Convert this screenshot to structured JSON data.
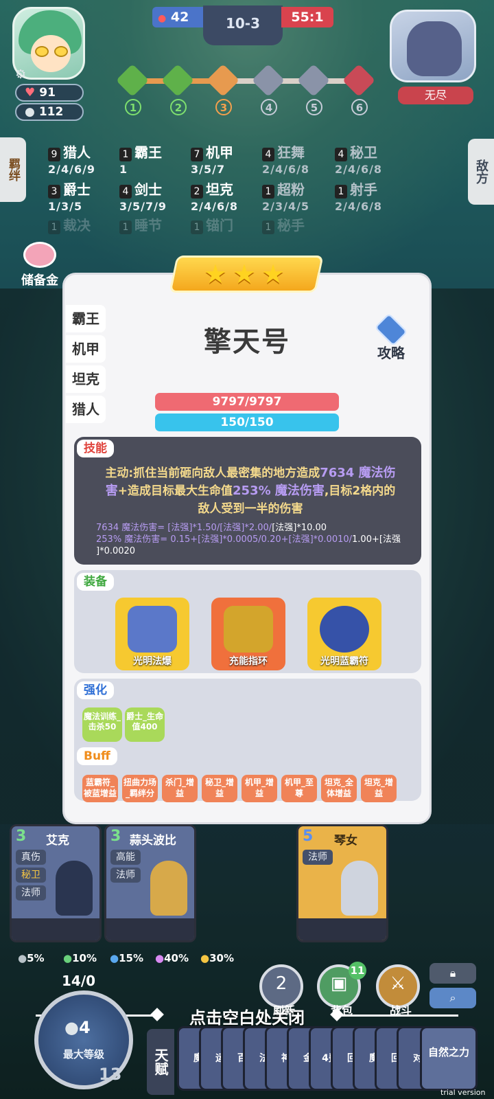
{
  "hud": {
    "enemy_kills": "42",
    "round": "10-3",
    "score": "55:1",
    "hp": "91",
    "coins": "112",
    "enemy_name": "无尽",
    "stages": [
      "1",
      "2",
      "3",
      "4",
      "5",
      "6"
    ]
  },
  "traits": {
    "tab_left": "羁绊",
    "tab_right": "敌方",
    "items": [
      {
        "count": "9",
        "name": "猎人",
        "levels": "2/4/6/9"
      },
      {
        "count": "1",
        "name": "霸王",
        "levels": "1"
      },
      {
        "count": "7",
        "name": "机甲",
        "levels": "3/5/7"
      },
      {
        "count": "4",
        "name": "狂舞",
        "levels": "2/4/6/8"
      },
      {
        "count": "4",
        "name": "秘卫",
        "levels": "2/4/6/8"
      },
      {
        "count": "3",
        "name": "爵士",
        "levels": "1/3/5"
      },
      {
        "count": "4",
        "name": "剑士",
        "levels": "3/5/7/9"
      },
      {
        "count": "2",
        "name": "坦克",
        "levels": "2/4/6/8"
      },
      {
        "count": "1",
        "name": "超粉",
        "levels": "2/3/4/5"
      },
      {
        "count": "1",
        "name": "射手",
        "levels": "2/4/6/8"
      },
      {
        "count": "1",
        "name": "裁决",
        "levels": ""
      },
      {
        "count": "1",
        "name": "睡节",
        "levels": ""
      },
      {
        "count": "1",
        "name": "锚门",
        "levels": ""
      },
      {
        "count": "1",
        "name": "秘手",
        "levels": ""
      }
    ]
  },
  "piggy_label": "储备金",
  "hero": {
    "name": "擎天号",
    "stars": "★★★",
    "trait_tabs": [
      "霸王",
      "机甲",
      "坦克",
      "猎人"
    ],
    "strategy_label": "攻略",
    "hp": "9797/9797",
    "mp": "150/150"
  },
  "skill": {
    "tag": "技能",
    "line1a": "主动:抓住当前砸向敌人最密集的地方造成",
    "line1b": "7634 魔法伤",
    "line2a": "害",
    "line2b": "+造成目标最大生命值",
    "line2c": "253% 魔法伤害",
    "line2d": ",目标2格内的",
    "line3": "敌人受到一半的伤害",
    "formula1a": "7634 魔法伤害= [法强]*1.50/[法强]*2.00/",
    "formula1b": "[法强]*10.00",
    "formula2a": "253% 魔法伤害= 0.15+[法强]*0.0005/0.20+[法强]*0.0010/",
    "formula2b": "1.00+[法强",
    "formula3": "]*0.0020"
  },
  "equipment": {
    "tag": "装备",
    "items": [
      {
        "name": "光明法爆",
        "icon": "gauntlet-icon",
        "color": "#f6c930"
      },
      {
        "name": "充能指环",
        "icon": "ring-icon",
        "color": "#f0703c"
      },
      {
        "name": "光明蓝霸符",
        "icon": "orb-icon",
        "color": "#f6c930"
      }
    ]
  },
  "boost": {
    "tag": "强化",
    "items": [
      "魔法训练_击杀50",
      "爵士_生命值400"
    ]
  },
  "buff": {
    "tag": "Buff",
    "items": [
      "蓝霸符_被蓝增益",
      "扭曲力场_羁绊分",
      "杀门_增益",
      "秘卫_增益",
      "机甲_增益",
      "机甲_至尊",
      "坦克_全体增益",
      "坦克_增益"
    ]
  },
  "shop": [
    {
      "cost": "3",
      "name": "艾克",
      "tags": [
        "真伤",
        "秘卫",
        "法师"
      ]
    },
    {
      "cost": "3",
      "name": "蒜头波比",
      "tags": [
        "高能",
        "法师"
      ]
    },
    {
      "cost": "5",
      "name": "琴女",
      "tags": [
        "法师"
      ]
    }
  ],
  "odds": [
    "5%",
    "10%",
    "15%",
    "40%",
    "30%"
  ],
  "odds_colors": [
    "#b8c2c8",
    "#6ad17b",
    "#5aa8ef",
    "#d98af2",
    "#f5c542"
  ],
  "buttons": {
    "refresh_cost": "2",
    "refresh_label": "刷新",
    "bag_count": "11",
    "bag_label": "背包",
    "battle_label": "战斗"
  },
  "close_hint": "点击空白处关闭",
  "level": {
    "xp": "14/0",
    "coins": "4",
    "label": "最大等级",
    "num": "13"
  },
  "talent": {
    "tab": "天赋",
    "cards": [
      "魔",
      "运",
      "百",
      "法",
      "神",
      "金",
      "4费",
      "回",
      "魔",
      "回",
      "对"
    ],
    "last": "自然之力"
  },
  "trial": "trial version"
}
